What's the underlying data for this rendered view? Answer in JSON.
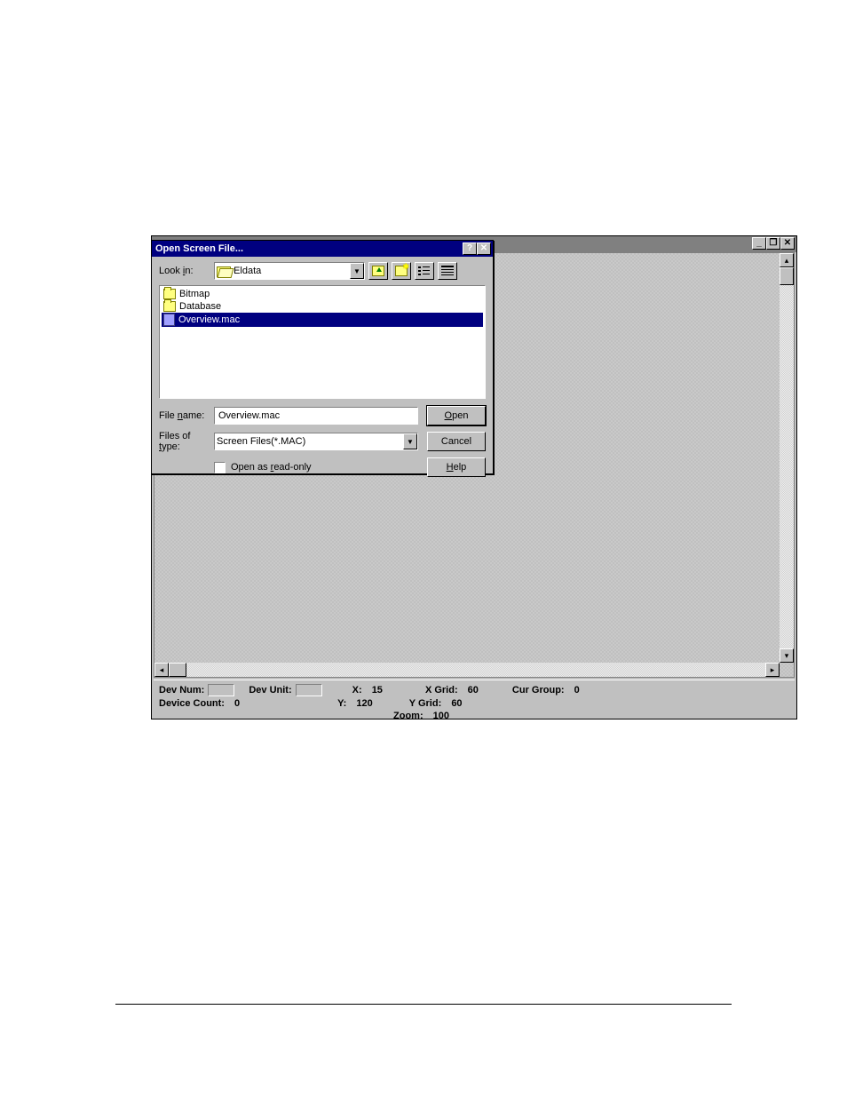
{
  "app_window": {
    "min_btn": "_",
    "restore_btn": "❐",
    "close_btn": "✕"
  },
  "dialog": {
    "title": "Open Screen File...",
    "help_btn": "?",
    "close_btn": "✕",
    "look_in_label": "Look in:",
    "look_in_value": "Eldata",
    "toolbar": {
      "up": "up-one-level",
      "new_folder": "create-new-folder",
      "list_view": "list",
      "details_view": "details"
    },
    "files": {
      "bitmap": "Bitmap",
      "database": "Database",
      "overview": "Overview.mac"
    },
    "file_name_label": "File name:",
    "file_name_value": "Overview.mac",
    "files_of_type_label": "Files of type:",
    "files_of_type_value": "Screen Files(*.MAC)",
    "read_only_label": "Open as read-only",
    "buttons": {
      "open": "Open",
      "cancel": "Cancel",
      "help": "Help"
    }
  },
  "status": {
    "dev_num_label": "Dev Num:",
    "dev_unit_label": "Dev Unit:",
    "device_count_label": "Device Count:",
    "device_count_value": "0",
    "x_label": "X:",
    "x_value": "15",
    "y_label": "Y:",
    "y_value": "120",
    "xgrid_label": "X Grid:",
    "xgrid_value": "60",
    "ygrid_label": "Y Grid:",
    "ygrid_value": "60",
    "zoom_label": "Zoom:",
    "zoom_value": "100",
    "curgroup_label": "Cur Group:",
    "curgroup_value": "0"
  }
}
